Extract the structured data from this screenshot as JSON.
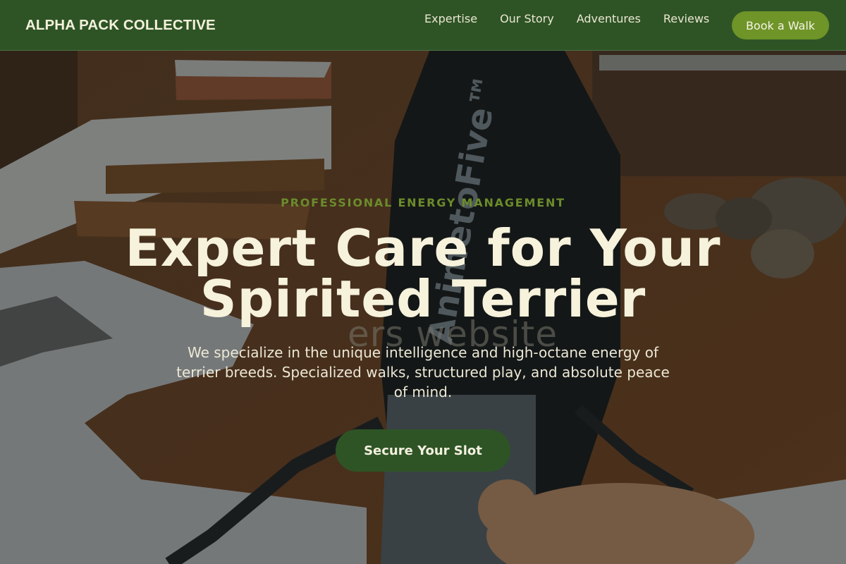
{
  "nav": {
    "brand": "ALPHA PACK COLLECTIVE",
    "links": [
      "Expertise",
      "Our Story",
      "Adventures",
      "Reviews"
    ],
    "cta": "Book a Walk"
  },
  "hero": {
    "eyebrow": "PROFESSIONAL ENERGY MANAGEMENT",
    "headline_line1": "Expert Care for Your",
    "headline_line2": "Spirited Terrier",
    "ghost_text": "ers website",
    "subtext": "We specialize in the unique intelligence and high-octane energy of terrier breeds. Specialized walks, structured play, and absolute peace of mind.",
    "cta": "Secure Your Slot",
    "background_image": "person-walking-dog-on-snowy-path",
    "shirt_print": "AnimetoFive™"
  },
  "colors": {
    "nav_bg": "#2e5426",
    "accent_green": "#6f9428",
    "eyebrow": "#6b8c2b",
    "headline": "#f6f2dc"
  }
}
